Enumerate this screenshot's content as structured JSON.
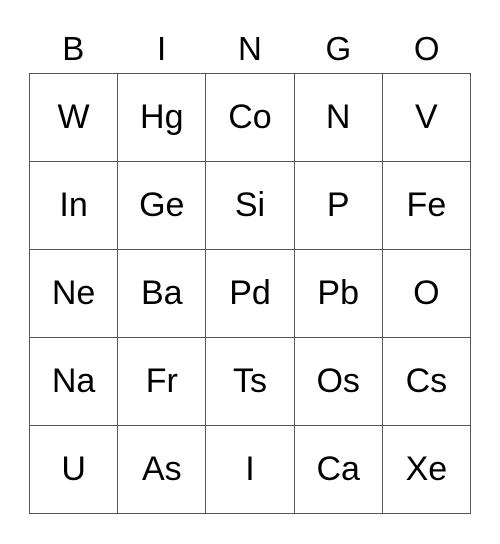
{
  "header": [
    "B",
    "I",
    "N",
    "G",
    "O"
  ],
  "rows": [
    [
      "W",
      "Hg",
      "Co",
      "N",
      "V"
    ],
    [
      "In",
      "Ge",
      "Si",
      "P",
      "Fe"
    ],
    [
      "Ne",
      "Ba",
      "Pd",
      "Pb",
      "O"
    ],
    [
      "Na",
      "Fr",
      "Ts",
      "Os",
      "Cs"
    ],
    [
      "U",
      "As",
      "I",
      "Ca",
      "Xe"
    ]
  ]
}
